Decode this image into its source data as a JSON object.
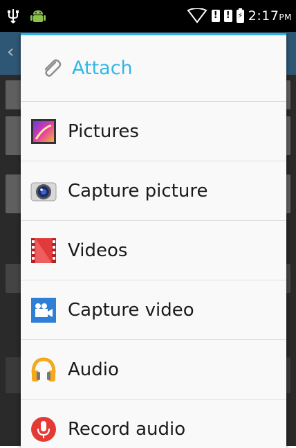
{
  "status_bar": {
    "time": "2:17",
    "ampm": "PM",
    "icons": [
      "usb-icon",
      "android-debug-icon",
      "wifi-icon",
      "sim-alert-icon",
      "sim-alert-icon",
      "battery-charging-icon"
    ]
  },
  "dialog": {
    "title": "Attach",
    "title_icon": "paperclip-icon",
    "accent_color": "#33b5e5",
    "items": [
      {
        "label": "Pictures",
        "icon": "gallery-icon"
      },
      {
        "label": "Capture picture",
        "icon": "camera-icon"
      },
      {
        "label": "Videos",
        "icon": "film-strip-icon"
      },
      {
        "label": "Capture video",
        "icon": "video-camera-icon"
      },
      {
        "label": "Audio",
        "icon": "headphones-icon"
      },
      {
        "label": "Record audio",
        "icon": "microphone-icon"
      }
    ]
  }
}
